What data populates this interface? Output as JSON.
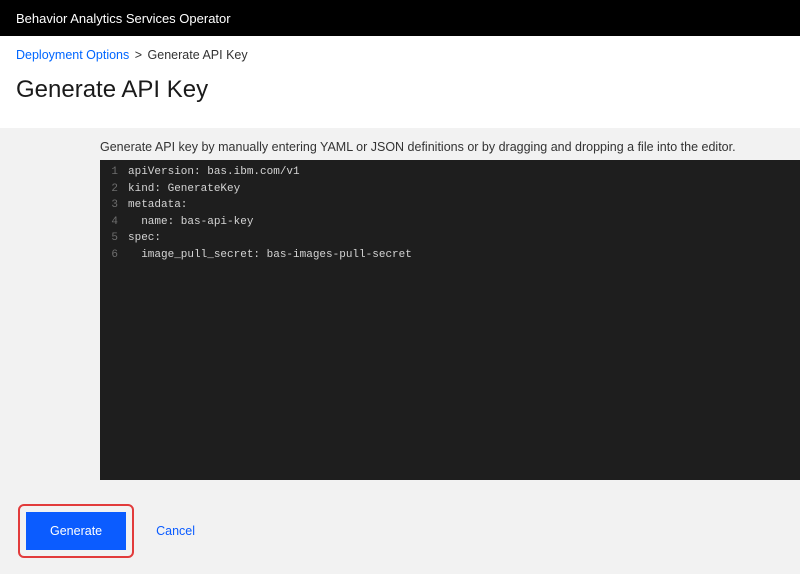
{
  "header": {
    "title": "Behavior Analytics Services Operator"
  },
  "breadcrumb": {
    "link": "Deployment Options",
    "separator": ">",
    "current": "Generate API Key"
  },
  "page": {
    "title": "Generate API Key",
    "instructions": "Generate API key by manually entering YAML or JSON definitions or by dragging and dropping a file into the editor."
  },
  "editor": {
    "lines": [
      "apiVersion: bas.ibm.com/v1",
      "kind: GenerateKey",
      "metadata:",
      "  name: bas-api-key",
      "spec:",
      "  image_pull_secret: bas-images-pull-secret"
    ]
  },
  "footer": {
    "generate_label": "Generate",
    "cancel_label": "Cancel"
  }
}
